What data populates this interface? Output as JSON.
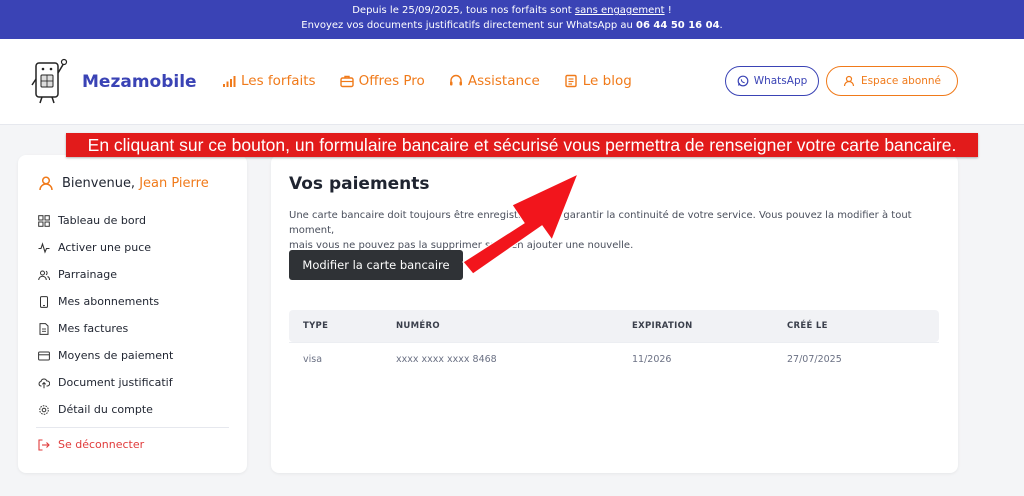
{
  "announcement": {
    "line1_prefix": "Depuis le 25/09/2025, tous nos forfaits sont ",
    "line1_link": "sans engagement",
    "line1_suffix": " !",
    "line2_prefix": "Envoyez vos documents justificatifs directement sur WhatsApp au ",
    "line2_phone": "06 44 50 16 04",
    "line2_suffix": "."
  },
  "header": {
    "brand": "Mezamobile",
    "nav": [
      {
        "label": "Les forfaits",
        "icon": "signal-icon"
      },
      {
        "label": "Offres Pro",
        "icon": "briefcase-icon"
      },
      {
        "label": "Assistance",
        "icon": "headset-icon"
      },
      {
        "label": "Le blog",
        "icon": "newspaper-icon"
      }
    ],
    "whatsapp_label": "WhatsApp",
    "subscriber_label": "Espace abonné"
  },
  "annotation": {
    "banner_text": "En cliquant sur ce bouton, un formulaire bancaire et sécurisé vous permettra de renseigner votre carte bancaire."
  },
  "sidebar": {
    "welcome_prefix": "Bienvenue, ",
    "user_name": "Jean Pierre",
    "items": [
      {
        "label": "Tableau de bord",
        "icon": "dashboard-icon"
      },
      {
        "label": "Activer une puce",
        "icon": "activity-icon"
      },
      {
        "label": "Parrainage",
        "icon": "users-icon"
      },
      {
        "label": "Mes abonnements",
        "icon": "phone-icon"
      },
      {
        "label": "Mes factures",
        "icon": "document-icon"
      },
      {
        "label": "Moyens de paiement",
        "icon": "credit-card-icon"
      },
      {
        "label": "Document justificatif",
        "icon": "upload-cloud-icon"
      },
      {
        "label": "Détail du compte",
        "icon": "gear-icon"
      }
    ],
    "logout_label": "Se déconnecter"
  },
  "main": {
    "title": "Vos paiements",
    "description_line1": "Une carte bancaire doit toujours être enregistrée pour garantir la continuité de votre service. Vous pouvez la modifier à tout moment,",
    "description_line2": "mais vous ne pouvez pas la supprimer sans en ajouter une nouvelle.",
    "modify_button": "Modifier la carte bancaire",
    "table": {
      "headers": [
        "TYPE",
        "NUMÉRO",
        "EXPIRATION",
        "CRÉÉ LE"
      ],
      "rows": [
        {
          "type": "visa",
          "number": "xxxx xxxx xxxx 8468",
          "expiration": "11/2026",
          "created": "27/07/2025"
        }
      ]
    }
  },
  "colors": {
    "primary": "#3a43b5",
    "accent": "#f07a1a",
    "banner_red": "#e21b1b",
    "dark_button": "#2f3236"
  }
}
